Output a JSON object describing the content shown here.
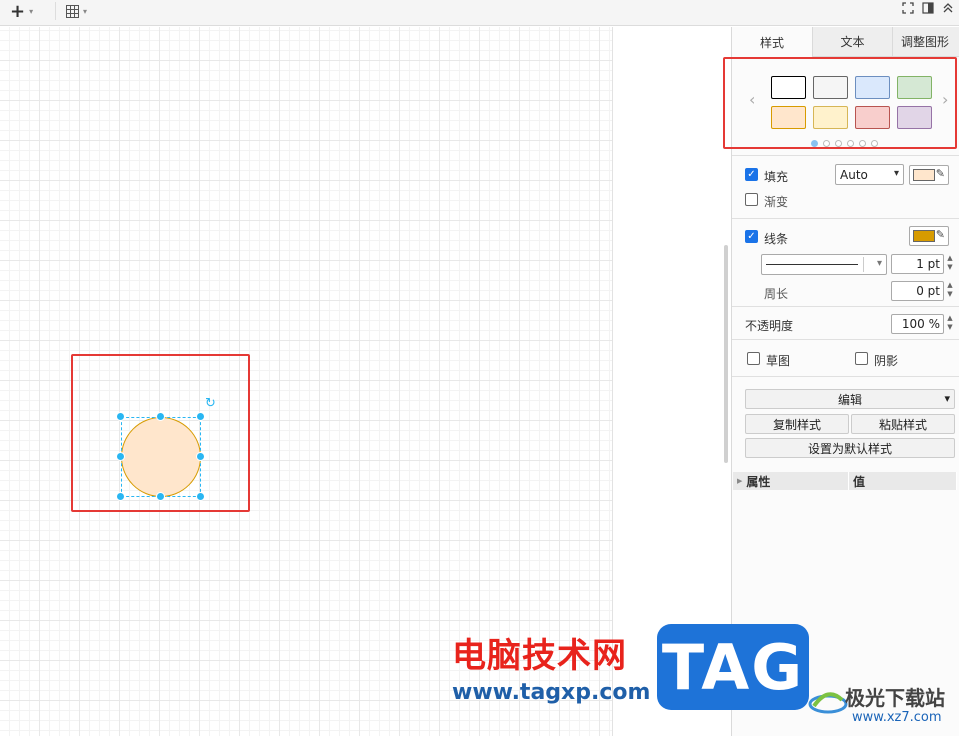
{
  "toolbar": {
    "insert_icon": "plus-icon",
    "table_icon": "table-icon",
    "caret": "▾"
  },
  "panel": {
    "tabs": [
      {
        "label": "样式"
      },
      {
        "label": "文本"
      },
      {
        "label": "调整图形"
      }
    ],
    "style_swatches": [
      {
        "fill": "#ffffff",
        "stroke": "#000000"
      },
      {
        "fill": "#f5f5f5",
        "stroke": "#666666"
      },
      {
        "fill": "#dae8fc",
        "stroke": "#6c8ebf"
      },
      {
        "fill": "#d5e8d4",
        "stroke": "#82b366"
      },
      {
        "fill": "#ffe6cc",
        "stroke": "#d79b00"
      },
      {
        "fill": "#fff2cc",
        "stroke": "#d6b656"
      },
      {
        "fill": "#f8cecc",
        "stroke": "#b85450"
      },
      {
        "fill": "#e1d5e7",
        "stroke": "#9673a6"
      }
    ],
    "swatch_pages": 6,
    "swatch_page_active": 1,
    "fill": {
      "label": "填充",
      "checked": true,
      "mode": "Auto",
      "color": "#ffe6cc"
    },
    "gradient": {
      "label": "渐变",
      "checked": false
    },
    "line": {
      "label": "线条",
      "checked": true,
      "color": "#d79b00",
      "width": "1 pt"
    },
    "perimeter": {
      "label": "周长",
      "value": "0 pt"
    },
    "opacity": {
      "label": "不透明度",
      "value": "100 %"
    },
    "sketch": {
      "label": "草图",
      "checked": false
    },
    "shadow": {
      "label": "阴影",
      "checked": false
    },
    "edit_label": "编辑",
    "copy_style": "复制样式",
    "paste_style": "粘贴样式",
    "set_default": "设置为默认样式",
    "table_headers": [
      "属性",
      "值"
    ]
  },
  "shape": {
    "type": "ellipse",
    "fill": "#ffe6cc",
    "stroke": "#d79b00"
  },
  "watermark": {
    "line1": "电脑技术网",
    "line2": "www.tagxp.com",
    "tag": "TAG",
    "site_name": "极光下载站",
    "site_url": "www.xz7.com"
  }
}
